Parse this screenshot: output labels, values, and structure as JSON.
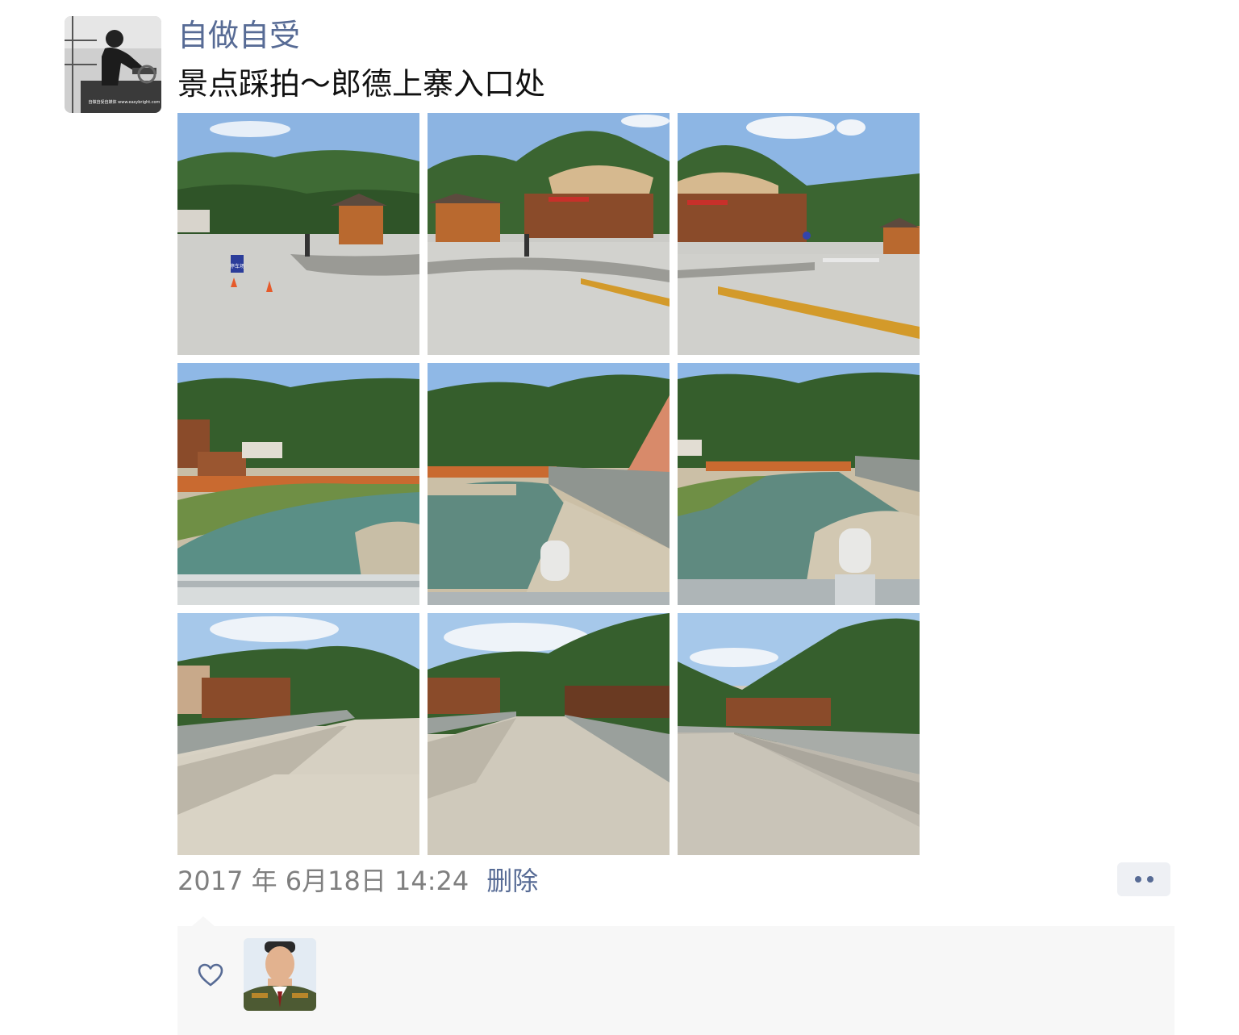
{
  "post": {
    "author_name": "自做自受",
    "text": "景点踩拍～郎德上寨入口处",
    "avatar_watermark": "自做自受自媒体 www.easybright.com",
    "photos": [
      {
        "scene": "plaza-entrance",
        "sign_text": "停车场"
      },
      {
        "scene": "plaza-building"
      },
      {
        "scene": "plaza-building-right"
      },
      {
        "scene": "river-left"
      },
      {
        "scene": "river-center"
      },
      {
        "scene": "river-right"
      },
      {
        "scene": "bridge-left"
      },
      {
        "scene": "bridge-center"
      },
      {
        "scene": "bridge-right"
      }
    ],
    "timestamp": "2017 年 6月18日 14:24",
    "delete_label": "删除"
  },
  "likes": {
    "icon": "heart-icon",
    "users": [
      {
        "avatar": "officer-portrait"
      }
    ]
  },
  "colors": {
    "link": "#576b95",
    "panel_bg": "#f7f7f7",
    "meta_text": "#7f7f7f"
  }
}
